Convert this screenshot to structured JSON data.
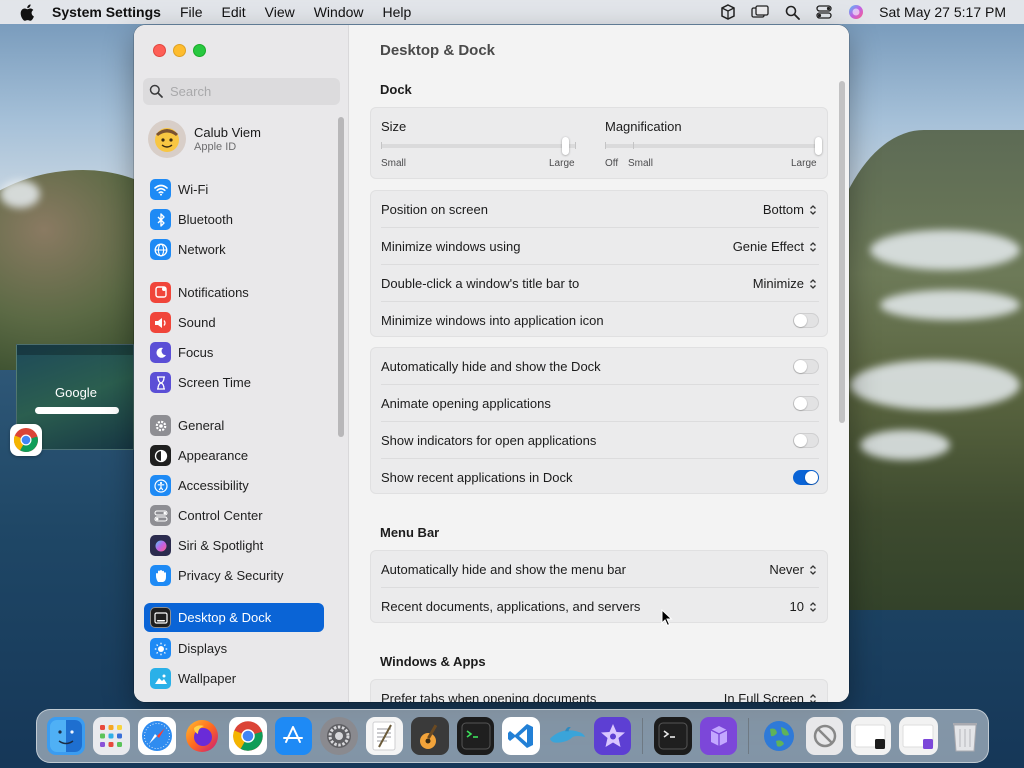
{
  "menubar": {
    "app_name": "System Settings",
    "menus": [
      "File",
      "Edit",
      "View",
      "Window",
      "Help"
    ],
    "datetime": "Sat May 27  5:17 PM"
  },
  "desktop": {
    "thumbnail_title": "Google"
  },
  "sidebar": {
    "search_placeholder": "Search",
    "account": {
      "name": "Calub Viem",
      "subtitle": "Apple ID"
    },
    "items": [
      {
        "label": "Wi-Fi",
        "icon": "wifi-icon",
        "color": "#1e8af5"
      },
      {
        "label": "Bluetooth",
        "icon": "bluetooth-icon",
        "color": "#1e8af5"
      },
      {
        "label": "Network",
        "icon": "globe-icon",
        "color": "#1e8af5"
      },
      {
        "label": "Notifications",
        "icon": "bell-icon",
        "color": "#f0453a"
      },
      {
        "label": "Sound",
        "icon": "speaker-icon",
        "color": "#f0453a"
      },
      {
        "label": "Focus",
        "icon": "moon-icon",
        "color": "#5b4fd6"
      },
      {
        "label": "Screen Time",
        "icon": "hourglass-icon",
        "color": "#5b4fd6"
      },
      {
        "label": "General",
        "icon": "gear-icon",
        "color": "#8e8e93"
      },
      {
        "label": "Appearance",
        "icon": "appearance-icon",
        "color": "#1f1f1f"
      },
      {
        "label": "Accessibility",
        "icon": "accessibility-icon",
        "color": "#1e8af5"
      },
      {
        "label": "Control Center",
        "icon": "control-center-icon",
        "color": "#8e8e93"
      },
      {
        "label": "Siri & Spotlight",
        "icon": "siri-icon",
        "color": "#2b2b4e"
      },
      {
        "label": "Privacy & Security",
        "icon": "hand-icon",
        "color": "#1e8af5"
      },
      {
        "label": "Desktop & Dock",
        "icon": "dock-icon",
        "color": "#1f1f1f"
      },
      {
        "label": "Displays",
        "icon": "sun-icon",
        "color": "#1e8af5"
      },
      {
        "label": "Wallpaper",
        "icon": "wallpaper-icon",
        "color": "#2ab0e8"
      }
    ],
    "selected": "Desktop & Dock"
  },
  "content": {
    "title": "Desktop & Dock",
    "dock_section": {
      "title": "Dock",
      "size": {
        "label": "Size",
        "min_caption": "Small",
        "max_caption": "Large",
        "value_fraction": 0.95
      },
      "magnification": {
        "label": "Magnification",
        "off_caption": "Off",
        "min_caption": "Small",
        "max_caption": "Large",
        "value_fraction": 1.0
      },
      "popups": [
        {
          "label": "Position on screen",
          "value": "Bottom"
        },
        {
          "label": "Minimize windows using",
          "value": "Genie Effect"
        },
        {
          "label": "Double-click a window's title bar to",
          "value": "Minimize"
        }
      ],
      "minimize_into_icon": {
        "label": "Minimize windows into application icon",
        "on": false
      },
      "toggles": [
        {
          "label": "Automatically hide and show the Dock",
          "on": false
        },
        {
          "label": "Animate opening applications",
          "on": false
        },
        {
          "label": "Show indicators for open applications",
          "on": false
        },
        {
          "label": "Show recent applications in Dock",
          "on": true
        }
      ]
    },
    "menubar_section": {
      "title": "Menu Bar",
      "rows": [
        {
          "label": "Automatically hide and show the menu bar",
          "value": "Never"
        },
        {
          "label": "Recent documents, applications, and servers",
          "value": "10"
        }
      ]
    },
    "windows_section": {
      "title": "Windows & Apps",
      "rows": [
        {
          "label": "Prefer tabs when opening documents",
          "value": "In Full Screen"
        }
      ]
    }
  },
  "dock": {
    "apps": [
      {
        "name": "finder-icon",
        "color": "#3b9cf0"
      },
      {
        "name": "launchpad-icon",
        "color": "#e9eaee"
      },
      {
        "name": "safari-icon",
        "color": "#2f8cf0"
      },
      {
        "name": "firefox-icon",
        "color": "#f26b1d"
      },
      {
        "name": "chrome-icon",
        "color": "#ffffff"
      },
      {
        "name": "app-store-icon",
        "color": "#1e8af5"
      },
      {
        "name": "system-settings-icon",
        "color": "#8a8a8f"
      },
      {
        "name": "textedit-icon",
        "color": "#f4f4f4"
      },
      {
        "name": "garageband-icon",
        "color": "#3a3a3a"
      },
      {
        "name": "terminal-icon",
        "color": "#1c1c1c"
      },
      {
        "name": "vscode-icon",
        "color": "#2280d6"
      },
      {
        "name": "dolphin-emulator-icon",
        "color": "#3aa4d9"
      },
      {
        "name": "imovie-icon",
        "color": "#5d3fd3"
      }
    ],
    "apps_recent": [
      {
        "name": "terminal-icon",
        "color": "#1c1c1c"
      },
      {
        "name": "utm-icon",
        "color": "#7c47d9"
      }
    ],
    "apps_stacks": [
      {
        "name": "internet-globe-icon",
        "color": "#2f7ad8"
      },
      {
        "name": "preview-no-icon",
        "color": "#e8e8ea"
      },
      {
        "name": "downloads-stack-icon",
        "color": "#f2f2f2"
      },
      {
        "name": "documents-stack-icon",
        "color": "#f2f2f2"
      },
      {
        "name": "trash-icon",
        "color": "#d6d7da"
      }
    ]
  }
}
